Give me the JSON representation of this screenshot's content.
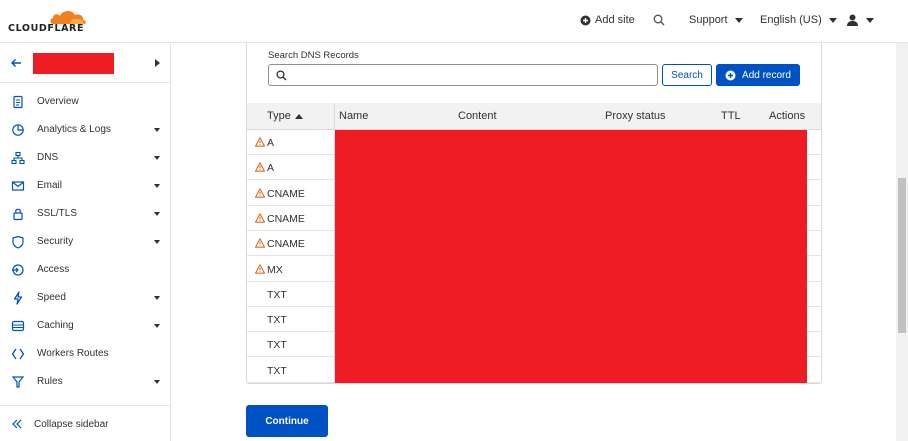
{
  "brand": {
    "name": "CLOUDFLARE",
    "accent": "#f38020"
  },
  "header": {
    "add_site": "Add site",
    "support": "Support",
    "language": "English (US)"
  },
  "sidebar": {
    "items": [
      {
        "label": "Overview",
        "icon": "document-icon",
        "caret": false
      },
      {
        "label": "Analytics & Logs",
        "icon": "chart-icon",
        "caret": true
      },
      {
        "label": "DNS",
        "icon": "network-icon",
        "caret": true
      },
      {
        "label": "Email",
        "icon": "email-icon",
        "caret": true
      },
      {
        "label": "SSL/TLS",
        "icon": "lock-icon",
        "caret": true
      },
      {
        "label": "Security",
        "icon": "shield-icon",
        "caret": true
      },
      {
        "label": "Access",
        "icon": "access-icon",
        "caret": false
      },
      {
        "label": "Speed",
        "icon": "lightning-icon",
        "caret": true
      },
      {
        "label": "Caching",
        "icon": "caching-icon",
        "caret": true
      },
      {
        "label": "Workers Routes",
        "icon": "workers-icon",
        "caret": false
      },
      {
        "label": "Rules",
        "icon": "rules-icon",
        "caret": true
      }
    ],
    "collapse_label": "Collapse sidebar"
  },
  "dns": {
    "search_label": "Search DNS Records",
    "search_value": "",
    "search_button": "Search",
    "add_button": "Add record",
    "columns": {
      "type": "Type",
      "name": "Name",
      "content": "Content",
      "proxy": "Proxy status",
      "ttl": "TTL",
      "actions": "Actions"
    },
    "rows": [
      {
        "type": "A",
        "warning": true
      },
      {
        "type": "A",
        "warning": true
      },
      {
        "type": "CNAME",
        "warning": true
      },
      {
        "type": "CNAME",
        "warning": true
      },
      {
        "type": "CNAME",
        "warning": true
      },
      {
        "type": "MX",
        "warning": true
      },
      {
        "type": "TXT",
        "warning": false
      },
      {
        "type": "TXT",
        "warning": false
      },
      {
        "type": "TXT",
        "warning": false
      },
      {
        "type": "TXT",
        "warning": false
      }
    ]
  },
  "continue_button": "Continue",
  "colors": {
    "primary": "#0051c3",
    "warning": "#e06c1a",
    "redaction": "#ee1d24"
  }
}
